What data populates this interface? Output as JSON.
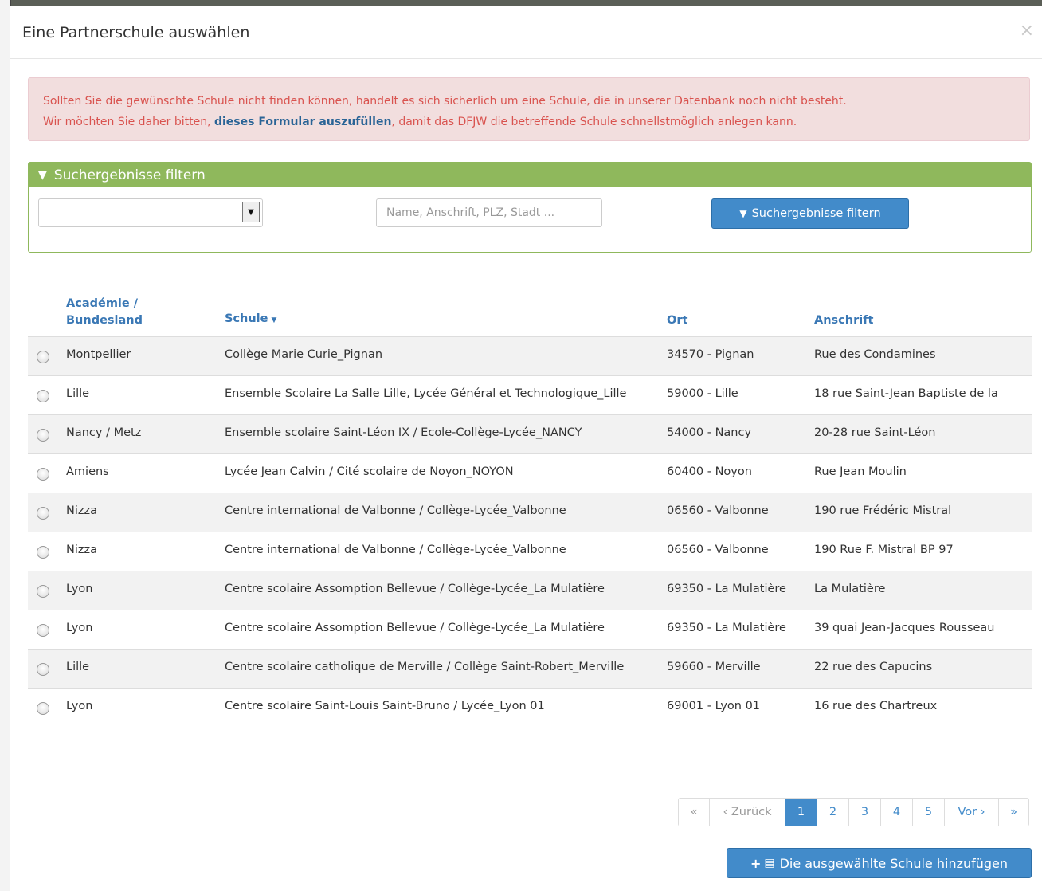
{
  "modal": {
    "title": "Eine Partnerschule auswählen",
    "close_symbol": "×"
  },
  "alert": {
    "line1": "Sollten Sie die gewünschte Schule nicht finden können, handelt es sich sicherlich um eine Schule, die in unserer Datenbank noch nicht besteht.",
    "line2_before": "Wir möchten Sie daher bitten, ",
    "link_text": "dieses Formular auszufüllen",
    "line2_after": ", damit das DFJW die betreffende Schule schnellstmöglich anlegen kann."
  },
  "filter": {
    "heading": "Suchergebnisse filtern",
    "select_value": "",
    "search_placeholder": "Name, Anschrift, PLZ, Stadt ...",
    "search_value": "",
    "button_label": "Suchergebnisse filtern",
    "icon": "filter-icon"
  },
  "table": {
    "headers": {
      "region_line1": "Académie /",
      "region_line2": "Bundesland",
      "school": "Schule",
      "ort": "Ort",
      "address": "Anschrift"
    },
    "rows": [
      {
        "region": "Montpellier",
        "school": "Collège Marie Curie_Pignan",
        "ort": "34570 - Pignan",
        "address": "Rue des Condamines"
      },
      {
        "region": "Lille",
        "school": "Ensemble Scolaire La Salle Lille, Lycée Général et Technologique_Lille",
        "ort": "59000 - Lille",
        "address": "18 rue Saint-Jean Baptiste de la"
      },
      {
        "region": "Nancy / Metz",
        "school": "Ensemble scolaire Saint-Léon IX / Ecole-Collège-Lycée_NANCY",
        "ort": "54000 - Nancy",
        "address": "20-28 rue Saint-Léon"
      },
      {
        "region": "Amiens",
        "school": "Lycée Jean Calvin / Cité scolaire de Noyon_NOYON",
        "ort": "60400 - Noyon",
        "address": "Rue Jean Moulin"
      },
      {
        "region": "Nizza",
        "school": "Centre international de Valbonne / Collège-Lycée_Valbonne",
        "ort": "06560 - Valbonne",
        "address": "190 rue Frédéric Mistral"
      },
      {
        "region": "Nizza",
        "school": "Centre international de Valbonne / Collège-Lycée_Valbonne",
        "ort": "06560 - Valbonne",
        "address": "190 Rue F. Mistral BP 97"
      },
      {
        "region": "Lyon",
        "school": "Centre scolaire Assomption Bellevue / Collège-Lycée_La Mulatière",
        "ort": "69350 - La Mulatière",
        "address": "La Mulatière"
      },
      {
        "region": "Lyon",
        "school": "Centre scolaire Assomption Bellevue / Collège-Lycée_La Mulatière",
        "ort": "69350 - La Mulatière",
        "address": "39 quai Jean-Jacques Rousseau"
      },
      {
        "region": "Lille",
        "school": "Centre scolaire catholique de Merville / Collège Saint-Robert_Merville",
        "ort": "59660 - Merville",
        "address": "22 rue des Capucins"
      },
      {
        "region": "Lyon",
        "school": "Centre scolaire Saint-Louis Saint-Bruno / Lycée_Lyon 01",
        "ort": "69001 - Lyon 01",
        "address": "16 rue des Chartreux"
      }
    ]
  },
  "pagination": {
    "first": "«",
    "prev": "‹ Zurück",
    "pages": [
      "1",
      "2",
      "3",
      "4",
      "5"
    ],
    "active_page": "1",
    "next": "Vor ›",
    "last": "»"
  },
  "add_button": {
    "label": "Die ausgewählte Schule hinzufügen",
    "icons": [
      "plus-icon",
      "building-icon"
    ]
  },
  "colors": {
    "accent": "#428bca",
    "panel_green": "#8fb85c",
    "alert_text": "#d9534f",
    "alert_bg": "#f2dede"
  }
}
